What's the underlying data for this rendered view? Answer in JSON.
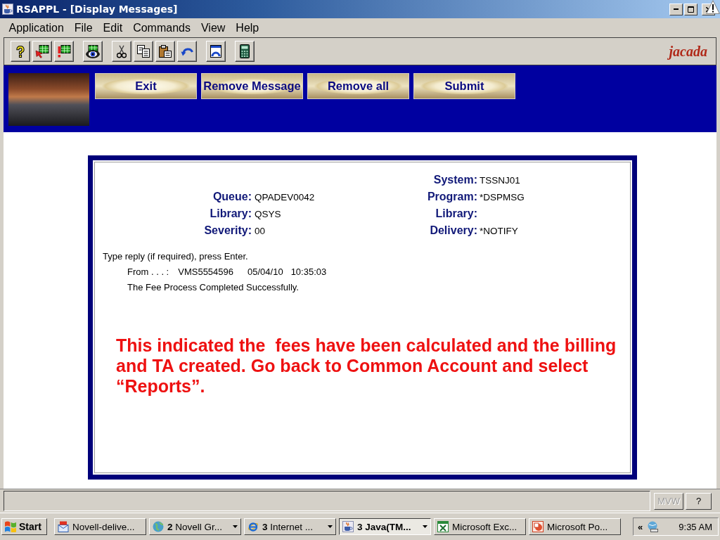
{
  "window": {
    "title": "RSAPPL - [Display Messages]"
  },
  "menu": [
    "Application",
    "File",
    "Edit",
    "Commands",
    "View",
    "Help"
  ],
  "toolbar": {
    "logo": "jacada"
  },
  "banner": {
    "buttons": [
      "Exit",
      "Remove Message",
      "Remove all",
      "Submit"
    ]
  },
  "message": {
    "fields_left": [
      {
        "label": "Queue:",
        "value": "QPADEV0042"
      },
      {
        "label": "Library:",
        "value": "QSYS"
      },
      {
        "label": "Severity:",
        "value": "00"
      }
    ],
    "fields_right": [
      {
        "label": "System:",
        "value": "TSSNJ01"
      },
      {
        "label": "Program:",
        "value": "*DSPMSG"
      },
      {
        "label": "Library:"
      },
      {
        "label": "Delivery:",
        "value": "*NOTIFY"
      }
    ],
    "prompt": "Type reply (if required), press Enter.",
    "from": {
      "label": "From . . . :",
      "user": "VMS5554596",
      "date": "05/04/10",
      "time": "10:35:03"
    },
    "text": "The Fee Process Completed Successfully."
  },
  "note": "This indicated the  fees have been calculated and the billing and TA created. Go back to Common Account and select “Reports”.",
  "status_bar": {
    "buttons": [
      {
        "label": "MVW",
        "disabled": true
      },
      {
        "label": "?",
        "disabled": false
      }
    ]
  },
  "taskbar": {
    "start": "Start",
    "items": [
      {
        "kind": "mail",
        "label": "Novell-delive...",
        "grouped": false,
        "selected": false
      },
      {
        "kind": "globe",
        "label": "**2** Novell Gr...",
        "grouped": true,
        "selected": false
      },
      {
        "kind": "browser",
        "label": "**3** Internet ...",
        "grouped": true,
        "selected": false
      },
      {
        "kind": "java",
        "label": "3 Java(TM...",
        "grouped": true,
        "selected": true
      },
      {
        "kind": "spreadsheet",
        "label": "Microsoft Exc...",
        "grouped": false,
        "selected": false
      },
      {
        "kind": "presentation",
        "label": "Microsoft Po...",
        "grouped": false,
        "selected": false
      }
    ],
    "tray": {
      "chevron": "«",
      "clock": "9:35 AM"
    }
  }
}
